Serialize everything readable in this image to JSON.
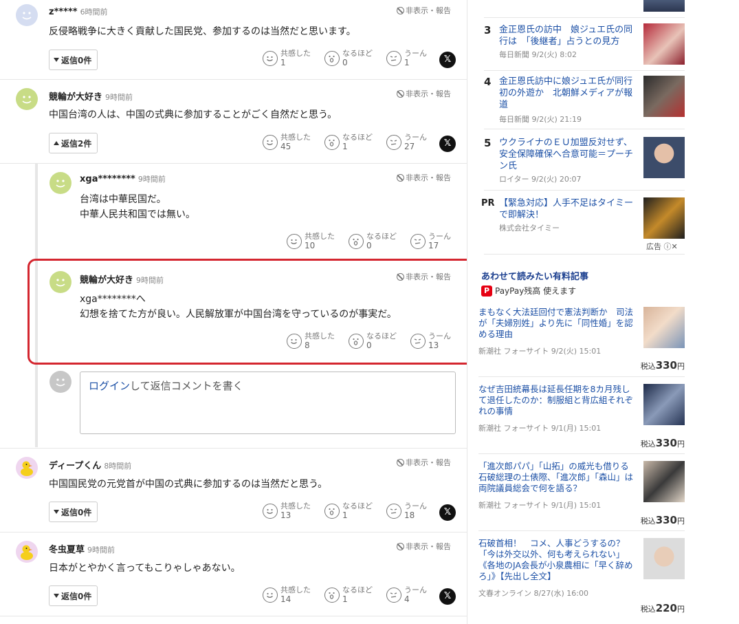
{
  "ui": {
    "hide_report": "非表示・報告",
    "empathy": "共感した",
    "naruhodo": "なるほど",
    "uun": "うーん",
    "x": "𝕏"
  },
  "comments": [
    {
      "user": "z*****",
      "time": "6時間前",
      "text": "反侵略戦争に大きく貢献した国民党、参加するのは当然だと思います。",
      "reply": "返信0件",
      "empathy": "1",
      "naruhodo": "0",
      "uun": "1"
    },
    {
      "user": "競輪が大好き",
      "time": "9時間前",
      "text": "中国台湾の人は、中国の式典に参加することがごく自然だと思う。",
      "reply": "返信2件",
      "empathy": "45",
      "naruhodo": "1",
      "uun": "27"
    },
    {
      "user": "xga********",
      "time": "9時間前",
      "text": "台湾は中華民国だ。\n中華人民共和国では無い。",
      "empathy": "10",
      "naruhodo": "0",
      "uun": "17"
    },
    {
      "user": "競輪が大好き",
      "time": "9時間前",
      "text": "xga********へ\n幻想を捨てた方が良い。人民解放軍が中国台湾を守っているのが事実だ。",
      "empathy": "8",
      "naruhodo": "0",
      "uun": "13"
    },
    {
      "user": "ディープくん",
      "time": "8時間前",
      "text": "中国国民党の元党首が中国の式典に参加するのは当然だと思う。",
      "reply": "返信0件",
      "empathy": "13",
      "naruhodo": "1",
      "uun": "18"
    },
    {
      "user": "冬虫夏草",
      "time": "9時間前",
      "text": "日本がとやかく言ってもこりゃしゃあない。",
      "reply": "返信0件",
      "empathy": "14",
      "naruhodo": "1",
      "uun": "4"
    }
  ],
  "reply_box": {
    "login": "ログイン",
    "rest": "して返信コメントを書く"
  },
  "ranking": [
    {
      "num": "3",
      "title": "金正恩氏の訪中　娘ジュエ氏の同行は　「後継者」占うとの見方",
      "meta": "毎日新聞 9/2(火) 8:02"
    },
    {
      "num": "4",
      "title": "金正恩氏訪中に娘ジュエ氏が同行　初の外遊か　北朝鮮メディアが報道",
      "meta": "毎日新聞 9/2(火) 21:19"
    },
    {
      "num": "5",
      "title": "ウクライナのＥＵ加盟反対せず、安全保障確保へ合意可能＝プーチン氏",
      "meta": "ロイター 9/2(火) 20:07"
    }
  ],
  "pr": {
    "label": "PR",
    "title": "【緊急対応】人手不足はタイミーで即解決！",
    "meta": "株式会社タイミー",
    "ad": "広告"
  },
  "paid_section": {
    "title": "あわせて読みたい有料記事",
    "paypay": "PayPay残高 使えます",
    "pp_logo": "P"
  },
  "paid": [
    {
      "title": "まもなく大法廷回付で憲法判断か　司法が「夫婦別姓」より先に「同性婚」を認める理由",
      "meta": "新潮社 フォーサイト 9/2(火) 15:01",
      "price_prefix": "税込",
      "price": "330",
      "unit": "円"
    },
    {
      "title": "なぜ吉田統幕長は延長任期を8カ月残して退任したのか：制服組と背広組それぞれの事情",
      "meta": "新潮社 フォーサイト 9/1(月) 15:01",
      "price_prefix": "税込",
      "price": "330",
      "unit": "円"
    },
    {
      "title": "「進次郎パパ」「山拓」の威光も借りる石破総理の土俵際、「進次郎」「森山」は両院議員総会で何を語る？",
      "meta": "新潮社 フォーサイト 9/1(月) 15:01",
      "price_prefix": "税込",
      "price": "330",
      "unit": "円"
    },
    {
      "title": "石破首相！　コメ、人事どうするの？「今は外交以外、何も考えられない」《各地のJA会長が小泉農相に「早く辞めろ」》【先出し全文】",
      "meta": "文春オンライン 8/27(水) 16:00",
      "price_prefix": "税込",
      "price": "220",
      "unit": "円"
    }
  ]
}
